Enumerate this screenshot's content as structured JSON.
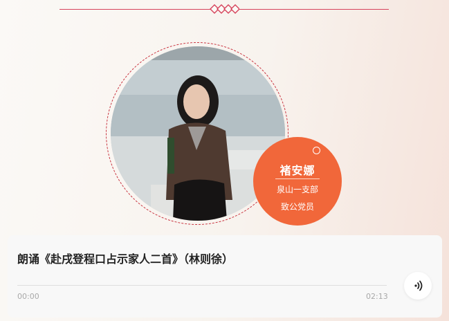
{
  "member": {
    "name": "褚安娜",
    "branch": "泉山一支部",
    "role": "致公党员"
  },
  "track": {
    "title": "朗诵《赴戌登程口占示家人二首》（林则徐）",
    "current_time": "00:00",
    "duration": "02:13",
    "progress": 0
  },
  "colors": {
    "accent": "#f1673a",
    "divider": "#d6415a"
  },
  "icons": {
    "ornament": "diamond-ornament-icon",
    "play": "audio-play-icon"
  }
}
